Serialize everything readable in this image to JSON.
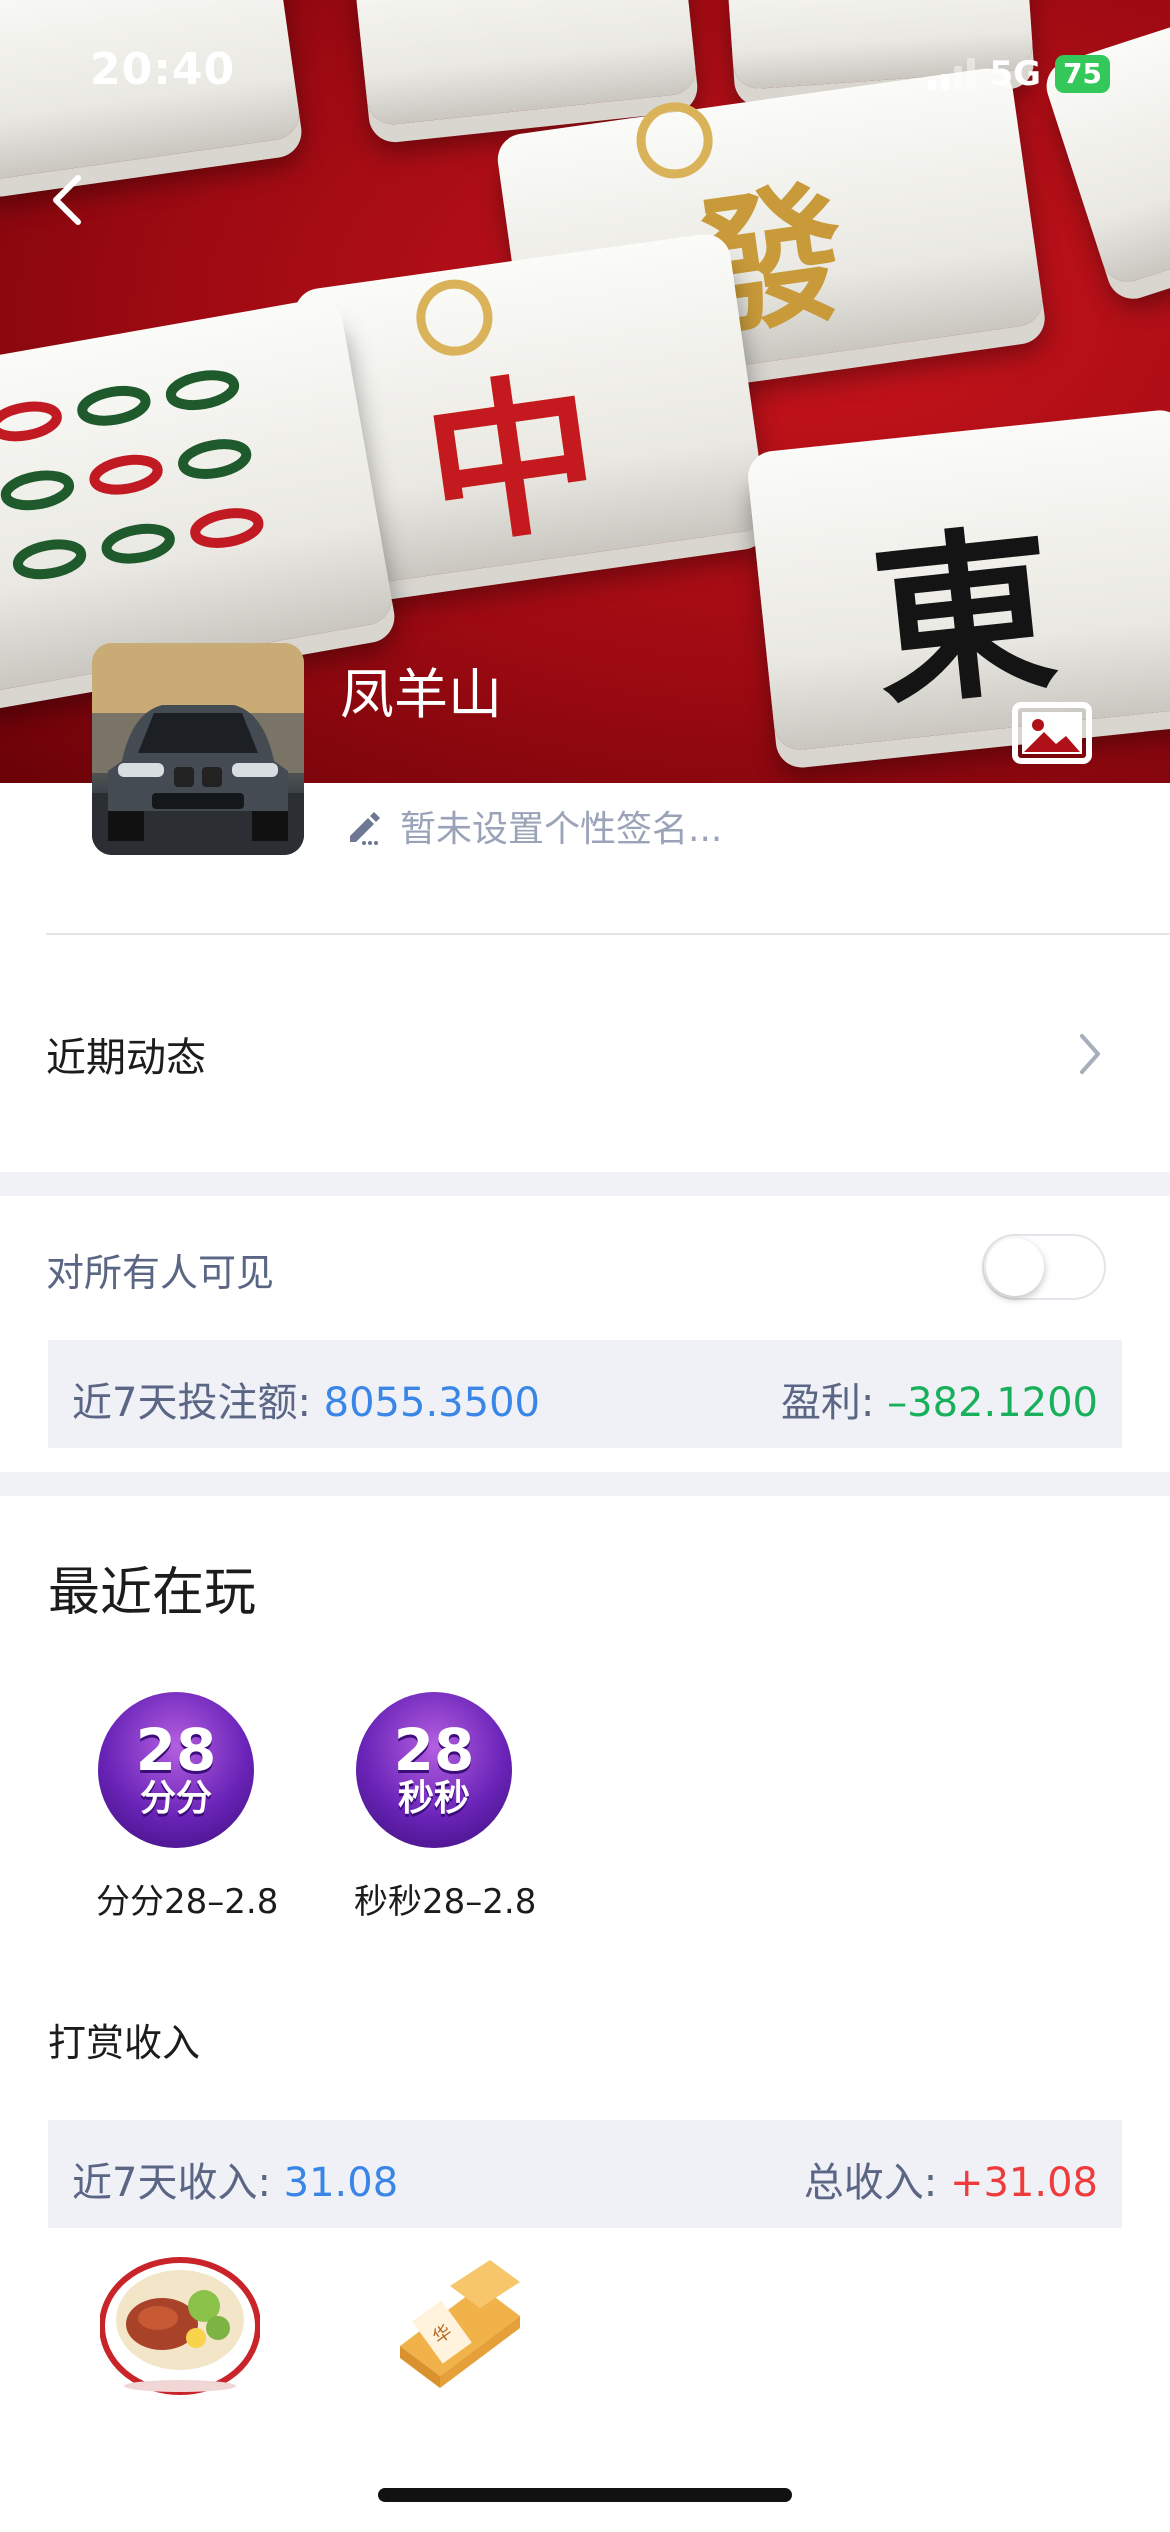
{
  "status_bar": {
    "time": "20:40",
    "network": "5G",
    "battery": "75"
  },
  "profile": {
    "name": "凤羊山",
    "signature_placeholder": "暂未设置个性签名..."
  },
  "recent_activity": {
    "label": "近期动态"
  },
  "visibility": {
    "label": "对所有人可见",
    "enabled": false
  },
  "bet_stats": {
    "label": "近7天投注额:",
    "amount": "8055.3500",
    "profit_label": "盈利:",
    "profit": "–382.1200"
  },
  "recently_playing": {
    "title": "最近在玩",
    "games": [
      {
        "logo_number": "28",
        "logo_chars": "分分",
        "name": "分分28–2.8"
      },
      {
        "logo_number": "28",
        "logo_chars": "秒秒",
        "name": "秒秒28–2.8"
      }
    ]
  },
  "tip_income": {
    "title": "打赏收入",
    "week_label": "近7天收入:",
    "week_value": "31.08",
    "total_label": "总收入:",
    "total_value": "+31.08",
    "gifts": [
      "braised-pork-rice-bowl",
      "pastry-gift"
    ]
  },
  "colors": {
    "accent_blue": "#3a86e6",
    "profit_green": "#18b05a",
    "income_red": "#ef3b3b"
  }
}
